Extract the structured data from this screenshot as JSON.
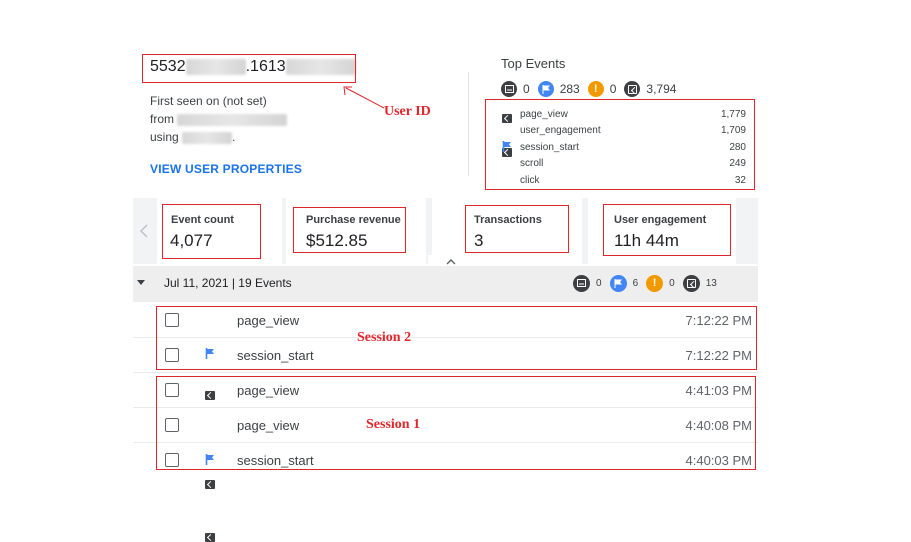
{
  "user": {
    "id_prefix": "5532",
    "id_suffix": ".1613",
    "first_seen": "First seen on (not set)",
    "from_label": "from",
    "using_label": "using",
    "using_tail": ".",
    "view_properties": "VIEW USER PROPERTIES"
  },
  "annotations": {
    "user_id": "User ID",
    "session2": "Session 2",
    "session1": "Session 1"
  },
  "top_events": {
    "title": "Top Events",
    "summary": {
      "screen": "0",
      "flag": "283",
      "warn": "0",
      "cursor": "3,794"
    },
    "items": [
      {
        "name": "page_view",
        "count": "1,779",
        "icon": "cursor-icon"
      },
      {
        "name": "user_engagement",
        "count": "1,709",
        "icon": "cursor-icon"
      },
      {
        "name": "session_start",
        "count": "280",
        "icon": "flag-icon"
      },
      {
        "name": "scroll",
        "count": "249",
        "icon": "cursor-icon"
      },
      {
        "name": "click",
        "count": "32",
        "icon": "cursor-icon"
      }
    ]
  },
  "metrics": [
    {
      "label": "Event count",
      "value": "4,077"
    },
    {
      "label": "Purchase revenue",
      "value": "$512.85"
    },
    {
      "label": "Transactions",
      "value": "3"
    },
    {
      "label": "User engagement",
      "value": "11h 44m"
    }
  ],
  "day": {
    "label": "Jul 11, 2021 | 19 Events",
    "summary": {
      "screen": "0",
      "flag": "6",
      "warn": "0",
      "cursor": "13"
    }
  },
  "events": [
    {
      "name": "page_view",
      "time": "7:12:22 PM",
      "icon": "cursor-icon"
    },
    {
      "name": "session_start",
      "time": "7:12:22 PM",
      "icon": "flag-icon"
    },
    {
      "name": "page_view",
      "time": "4:41:03 PM",
      "icon": "cursor-icon"
    },
    {
      "name": "page_view",
      "time": "4:40:08 PM",
      "icon": "cursor-icon"
    },
    {
      "name": "session_start",
      "time": "4:40:03 PM",
      "icon": "flag-icon"
    }
  ],
  "colors": {
    "accent_blue": "#1a73e8",
    "flag_blue": "#4285f4",
    "warn_orange": "#f29900",
    "annotation_red": "#e0262b",
    "icon_dark": "#3c4043"
  }
}
